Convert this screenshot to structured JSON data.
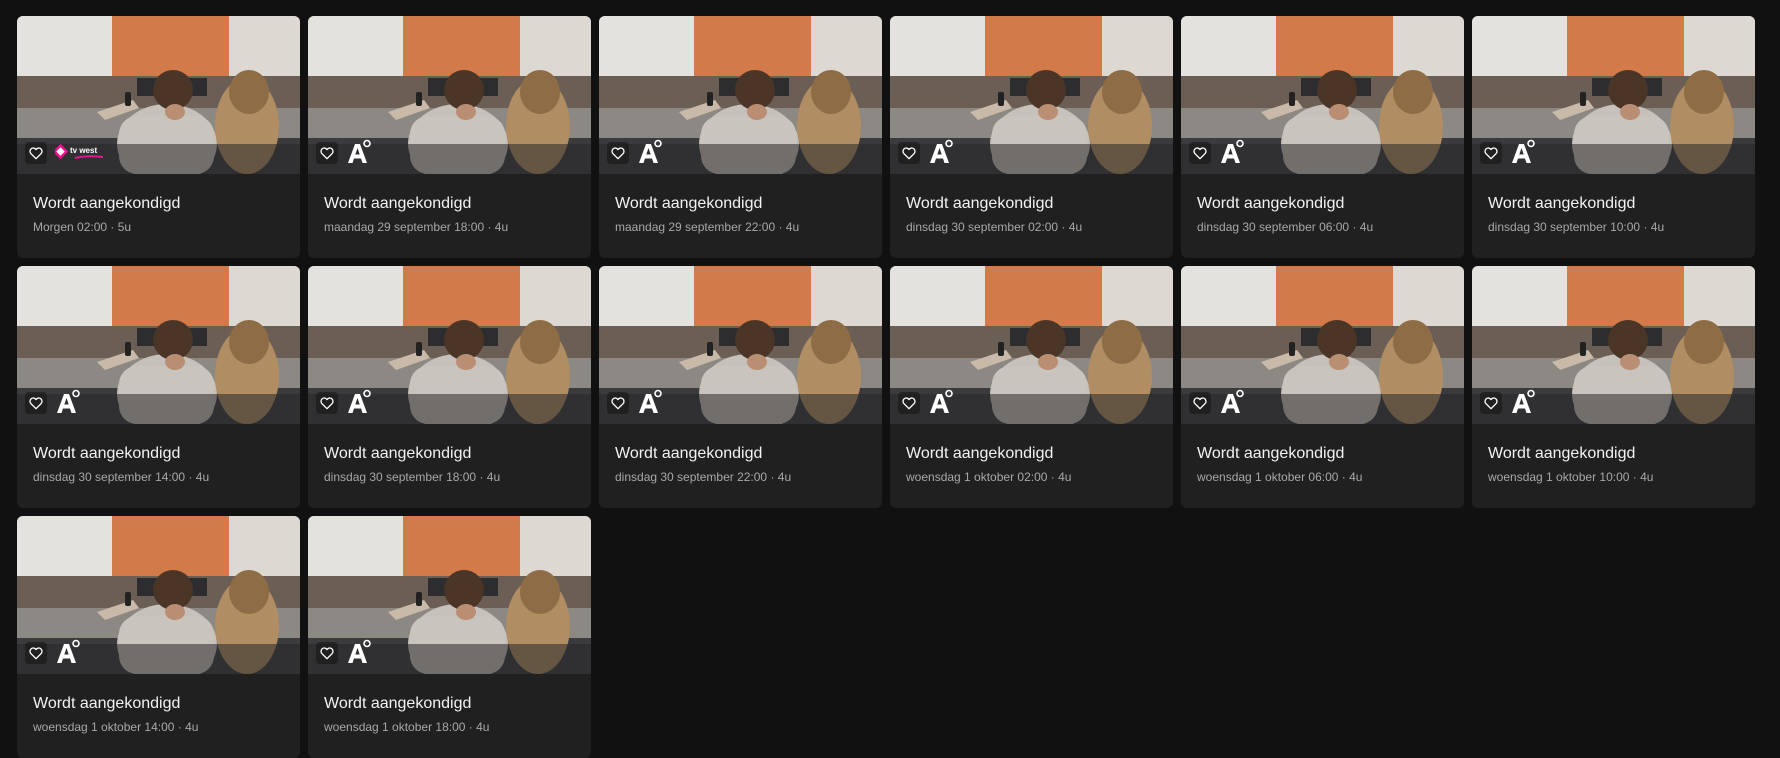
{
  "cards": [
    {
      "title": "Wordt aangekondigd",
      "subtitle": "Morgen 02:00 · 5u",
      "channel": "tv-west-logo",
      "channel_text": "tv west"
    },
    {
      "title": "Wordt aangekondigd",
      "subtitle": "maandag 29 september 18:00 · 4u",
      "channel": "a-channel-logo"
    },
    {
      "title": "Wordt aangekondigd",
      "subtitle": "maandag 29 september 22:00 · 4u",
      "channel": "a-channel-logo"
    },
    {
      "title": "Wordt aangekondigd",
      "subtitle": "dinsdag 30 september 02:00 · 4u",
      "channel": "a-channel-logo"
    },
    {
      "title": "Wordt aangekondigd",
      "subtitle": "dinsdag 30 september 06:00 · 4u",
      "channel": "a-channel-logo"
    },
    {
      "title": "Wordt aangekondigd",
      "subtitle": "dinsdag 30 september 10:00 · 4u",
      "channel": "a-channel-logo"
    },
    {
      "title": "Wordt aangekondigd",
      "subtitle": "dinsdag 30 september 14:00 · 4u",
      "channel": "a-channel-logo"
    },
    {
      "title": "Wordt aangekondigd",
      "subtitle": "dinsdag 30 september 18:00 · 4u",
      "channel": "a-channel-logo"
    },
    {
      "title": "Wordt aangekondigd",
      "subtitle": "dinsdag 30 september 22:00 · 4u",
      "channel": "a-channel-logo"
    },
    {
      "title": "Wordt aangekondigd",
      "subtitle": "woensdag 1 oktober 02:00 · 4u",
      "channel": "a-channel-logo"
    },
    {
      "title": "Wordt aangekondigd",
      "subtitle": "woensdag 1 oktober 06:00 · 4u",
      "channel": "a-channel-logo"
    },
    {
      "title": "Wordt aangekondigd",
      "subtitle": "woensdag 1 oktober 10:00 · 4u",
      "channel": "a-channel-logo"
    },
    {
      "title": "Wordt aangekondigd",
      "subtitle": "woensdag 1 oktober 14:00 · 4u",
      "channel": "a-channel-logo"
    },
    {
      "title": "Wordt aangekondigd",
      "subtitle": "woensdag 1 oktober 18:00 · 4u",
      "channel": "a-channel-logo"
    }
  ],
  "icons": {
    "favorite": "heart-outline-icon"
  },
  "colors": {
    "background": "#111111",
    "card": "#202020",
    "title": "#f2f2f2",
    "subtitle": "#a8a8a8",
    "tv_west_accent": "#e0168c"
  }
}
